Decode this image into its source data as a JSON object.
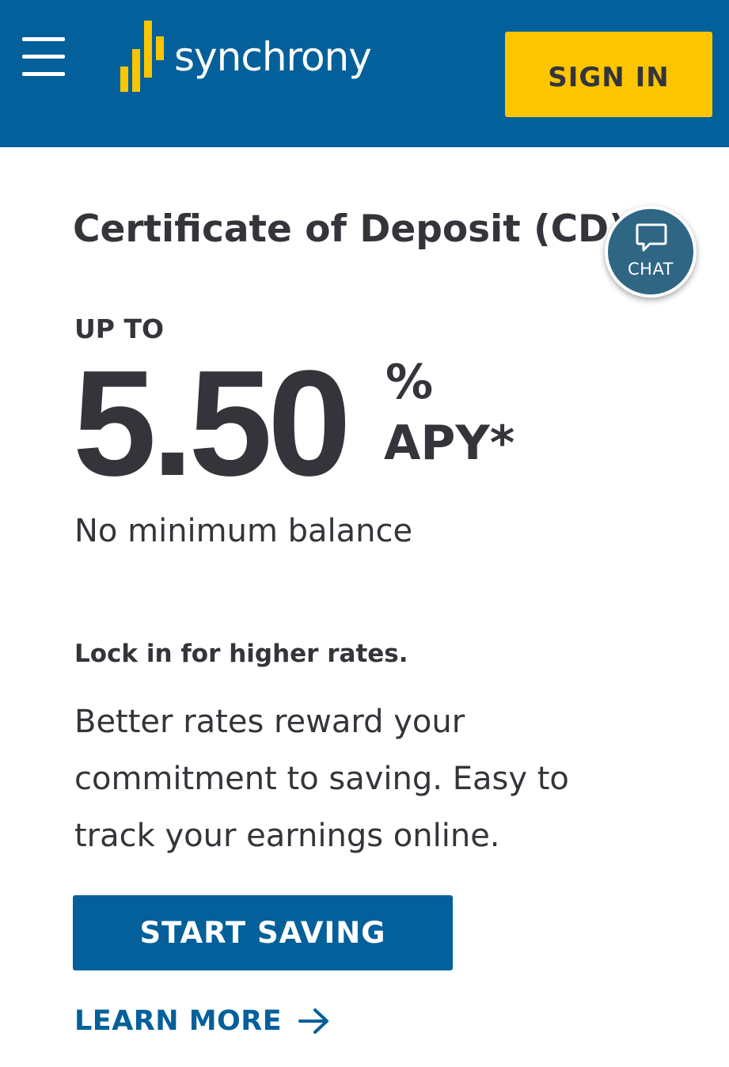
{
  "header": {
    "brand_name": "synchrony",
    "sign_in_label": "SIGN IN",
    "background_color": "#03609a",
    "accent_color": "#fbc600",
    "menu_icon": "hamburger-menu-icon",
    "logo_icon": "synchrony-bars-logo-icon"
  },
  "main": {
    "title": "Certificate of Deposit (CD)",
    "rate_prefix": "UP TO",
    "rate_value": "5.50",
    "rate_percent": "%",
    "rate_suffix": "APY*",
    "min_balance": "No minimum balance",
    "lock_heading": "Lock in for higher rates.",
    "body_text": "Better rates reward your commitment to saving. Easy to track your earnings online.",
    "start_button_label": "START SAVING",
    "learn_more_label": "LEARN MORE",
    "learn_more_icon": "arrow-right-icon"
  },
  "chat": {
    "label": "CHAT",
    "icon": "chat-bubble-icon",
    "color": "#2f6684"
  }
}
